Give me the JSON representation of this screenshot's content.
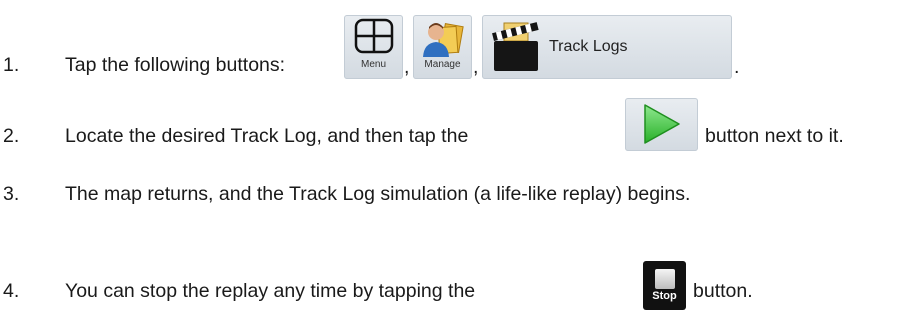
{
  "steps": [
    {
      "number": "1.",
      "text": "Tap the following buttons:",
      "sep1": ",",
      "sep2": ",",
      "end": "."
    },
    {
      "number": "2.",
      "before": "Locate the desired Track Log, and then tap the",
      "after": "button next to it."
    },
    {
      "number": "3.",
      "text": "The map returns, and the Track Log simulation (a life-like replay) begins."
    },
    {
      "number": "4.",
      "before": "You can stop the replay any time by tapping the",
      "after": "button."
    }
  ],
  "buttons": {
    "menu": {
      "label": "Menu",
      "icon": "menu-grid-icon"
    },
    "manage": {
      "label": "Manage",
      "icon": "user-folders-icon"
    },
    "track_logs": {
      "label": "Track Logs",
      "icon": "clapperboard-icon"
    },
    "play": {
      "icon": "play-triangle-icon"
    },
    "stop": {
      "label": "Stop",
      "icon": "stop-square-icon"
    }
  },
  "colors": {
    "button_bg": "#dfe5ea",
    "play_green": "#3cc43c",
    "stop_bg": "#111111"
  }
}
